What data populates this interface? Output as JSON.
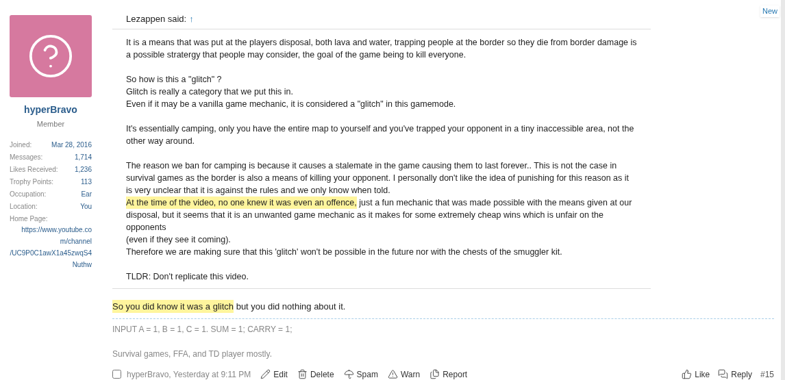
{
  "user": {
    "name": "hyperBravo",
    "title": "Member",
    "stats": [
      {
        "label": "Joined:",
        "value": "Mar 28, 2016"
      },
      {
        "label": "Messages:",
        "value": "1,714"
      },
      {
        "label": "Likes Received:",
        "value": "1,236"
      },
      {
        "label": "Trophy Points:",
        "value": "113"
      },
      {
        "label": "Occupation:",
        "value": "Ear"
      },
      {
        "label": "Location:",
        "value": "You"
      }
    ],
    "home_page": {
      "label": "Home Page:",
      "lines": [
        "https://www.youtube.co",
        "m/channel",
        "/UC9P0C1awX1a45zwqS4",
        "Nuthw"
      ]
    }
  },
  "new_tag": "New",
  "quote": {
    "author": "Lezappen said:",
    "arrow": "↑",
    "paragraphs": [
      [
        [
          {
            "text": "It is a means that was put at the players disposal, both lava and water, trapping people at the border so they die from border damage is a possible stratergy that people may consider, the goal of the game being to kill everyone.",
            "highlighted": false
          }
        ]
      ],
      [
        [
          {
            "text": "So how is this a \"glitch\" ?",
            "highlighted": false
          }
        ],
        [
          {
            "text": "Glitch is really a category that we put this in.",
            "highlighted": false
          }
        ],
        [
          {
            "text": "Even if it may be a vanilla game mechanic, it is considered a \"glitch\" in this gamemode.",
            "highlighted": false
          }
        ]
      ],
      [
        [
          {
            "text": "It's essentially camping, only you have the entire map to yourself and you've trapped your opponent in a tiny inaccessible area, not the other way around.",
            "highlighted": false
          }
        ]
      ],
      [
        [
          {
            "text": "The reason we ban for camping is because it causes a stalemate in the game causing them to last forever.. This is not the case in survival games as the border is also a means of killing your opponent. I personally don't like the idea of punishing for this reason as it is very unclear that it is against the rules and we only know when told.",
            "highlighted": false
          }
        ],
        [
          {
            "text": "At the time of the video, no one knew it was even an offence,",
            "highlighted": true
          },
          {
            "text": " just a fun mechanic that was made possible with the means given at our disposal, but it seems that it is an unwanted game mechanic as it makes for some extremely cheap wins which is unfair on the opponents",
            "highlighted": false
          }
        ],
        [
          {
            "text": "(even if they see it coming).",
            "highlighted": false
          }
        ],
        [
          {
            "text": "Therefore we are making sure that this 'glitch' won't be possible in the future nor with the chests of the smuggler kit.",
            "highlighted": false
          }
        ]
      ],
      [
        [
          {
            "text": "TLDR: Don't replicate this video.",
            "highlighted": false
          }
        ]
      ]
    ]
  },
  "reply": [
    {
      "text": "So you did know it was a glitch",
      "highlighted": true
    },
    {
      "text": " but you did nothing about it.",
      "highlighted": false
    }
  ],
  "signature": [
    "INPUT A = 1, B = 1, C = 1. SUM = 1; CARRY = 1;",
    "Survival games, FFA, and TD player mostly."
  ],
  "footer": {
    "checked": false,
    "byline": "hyperBravo, Yesterday at 9:11 PM",
    "actions": [
      {
        "kind": "edit",
        "label": "Edit"
      },
      {
        "kind": "delete",
        "label": "Delete"
      },
      {
        "kind": "spam",
        "label": "Spam"
      },
      {
        "kind": "warn",
        "label": "Warn"
      },
      {
        "kind": "report",
        "label": "Report"
      }
    ],
    "right_actions": [
      {
        "kind": "like",
        "label": "Like"
      },
      {
        "kind": "reply",
        "label": "Reply"
      }
    ],
    "post_number": "#15"
  }
}
